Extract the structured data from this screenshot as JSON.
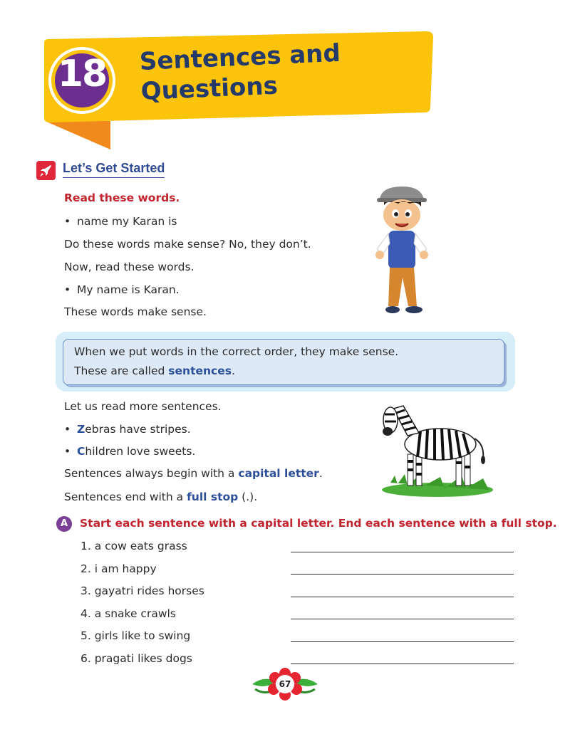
{
  "chapter": {
    "number": "18",
    "title_line1": "Sentences and",
    "title_line2": "Questions"
  },
  "section": {
    "icon": "rocket-icon",
    "title": "Let’s Get Started"
  },
  "intro": {
    "instruction": "Read these words.",
    "bullet1": "name my Karan is",
    "line1": "Do these words make sense? No, they don’t.",
    "line2": "Now, read these words.",
    "bullet2": "My name is Karan.",
    "line3": "These words make sense."
  },
  "info_box": {
    "line1": "When we put words in the correct order, they make sense.",
    "line2_prefix": "These are called ",
    "line2_bold": "sentences",
    "line2_suffix": "."
  },
  "more": {
    "line1": "Let us read more sentences.",
    "bullet1_cap": "Z",
    "bullet1_rest": "ebras have stripes.",
    "bullet2_cap": "C",
    "bullet2_rest": "hildren love sweets.",
    "line2_prefix": "Sentences always begin with a ",
    "line2_bold": "capital letter",
    "line2_suffix": ".",
    "line3_prefix": "Sentences end with a ",
    "line3_bold": "full stop",
    "line3_suffix": " (.)."
  },
  "exercise": {
    "badge": "A",
    "instruction": "Start each sentence with a capital letter. End each sentence with a full stop.",
    "items": [
      "1.  a cow eats grass",
      "2.  i am happy",
      "3.  gayatri rides horses",
      "4.  a snake crawls",
      "5.  girls like to swing",
      "6.  pragati likes dogs"
    ]
  },
  "page_number": "67",
  "colors": {
    "banner_yellow": "#fcc30b",
    "banner_fold": "#f08a1c",
    "title_blue": "#243a6b",
    "accent_red": "#c0242e",
    "accent_blue": "#2d4f9a",
    "badge_purple": "#7c3f98"
  }
}
